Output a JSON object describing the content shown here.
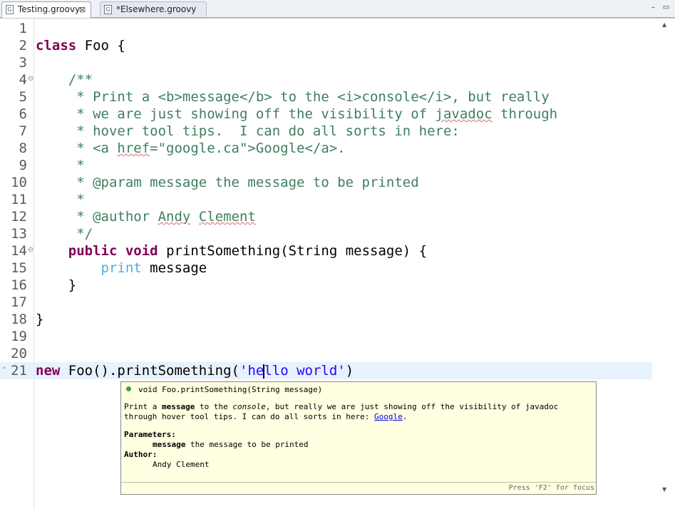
{
  "tabs": [
    {
      "label": "Testing.groovy",
      "active": true,
      "close": "⊠"
    },
    {
      "label": "*Elsewhere.groovy",
      "active": false
    }
  ],
  "window_controls": {
    "minimize": "–",
    "maximize": "▭"
  },
  "lines": [
    {
      "n": "1"
    },
    {
      "n": "2"
    },
    {
      "n": "3"
    },
    {
      "n": "4"
    },
    {
      "n": "5"
    },
    {
      "n": "6"
    },
    {
      "n": "7"
    },
    {
      "n": "8"
    },
    {
      "n": "9"
    },
    {
      "n": "10"
    },
    {
      "n": "11"
    },
    {
      "n": "12"
    },
    {
      "n": "13"
    },
    {
      "n": "14"
    },
    {
      "n": "15"
    },
    {
      "n": "16"
    },
    {
      "n": "17"
    },
    {
      "n": "18"
    },
    {
      "n": "19"
    },
    {
      "n": "20"
    },
    {
      "n": "21"
    }
  ],
  "code": {
    "l2_kw": "class",
    "l2_rest": " Foo {",
    "l4": "    /**",
    "l5": "     * Print a <b>message</b> to the <i>console</i>, but really",
    "l6a": "     * we are just showing off the visibility of ",
    "l6b": "javadoc",
    "l6c": " through",
    "l7": "     * hover tool tips.  I can do all sorts in here:",
    "l8a": "     * <a ",
    "l8b": "href",
    "l8c": "=\"google.ca\">Google</a>.",
    "l9": "     *",
    "l10": "     * @param message the message to be printed",
    "l11": "     *",
    "l12a": "     * @author ",
    "l12b": "Andy",
    "l12c": " ",
    "l12d": "Clement",
    "l13": "     */",
    "l14_indent": "    ",
    "l14_kw1": "public",
    "l14_sp": " ",
    "l14_kw2": "void",
    "l14_rest": " printSomething(String message) {",
    "l15_indent": "        ",
    "l15_kw": "print",
    "l15_rest": " message",
    "l16": "    }",
    "l18": "}",
    "l21_kw": "new",
    "l21_a": " Foo().",
    "l21_b": "printSomething(",
    "l21_s1": "'he",
    "l21_s2": "llo world'",
    "l21_c": ")"
  },
  "hover": {
    "signature": "void Foo.printSomething(String message)",
    "desc1_a": "Print a ",
    "desc1_b": "message",
    "desc1_c": " to the ",
    "desc1_d": "console",
    "desc1_e": ", but really we are just showing off the visibility of javadoc",
    "desc2_a": "through hover tool tips. I can do all sorts in here: ",
    "desc2_link": "Google",
    "desc2_b": ".",
    "params_label": "Parameters:",
    "param_name": "message",
    "param_desc": " the message to be printed",
    "author_label": "Author:",
    "author_name": "Andy Clement",
    "footer": "Press 'F2' for focus"
  },
  "colors": {
    "keyword": "#7f0055",
    "comment": "#3f7f5f",
    "string": "#2a00ff",
    "current_line": "#e8f2fe",
    "hover_bg": "#ffffe1"
  }
}
